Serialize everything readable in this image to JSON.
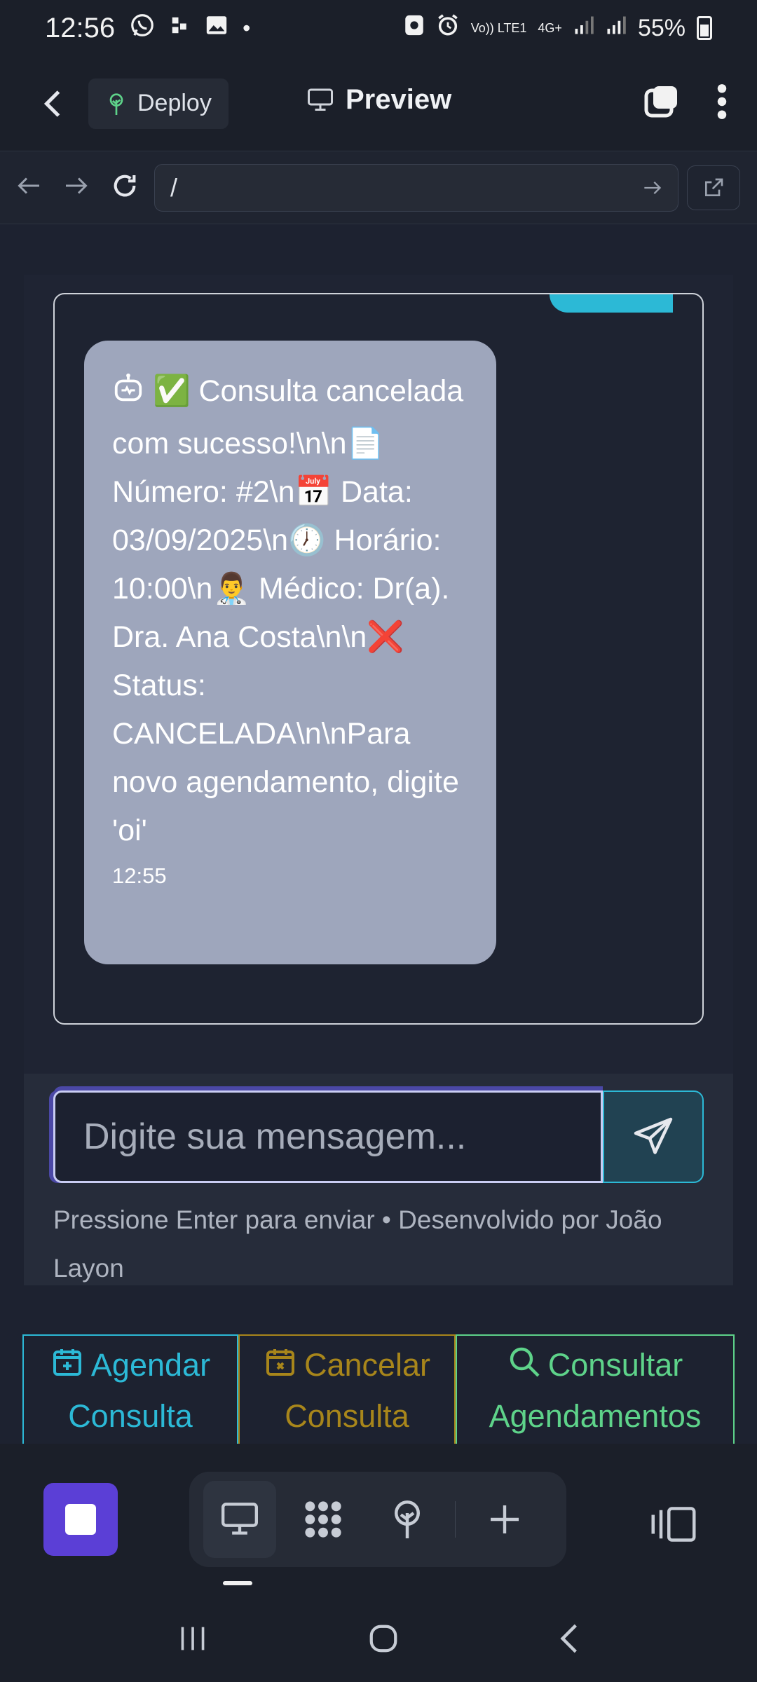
{
  "status_bar": {
    "time": "12:56",
    "network_label": "Vo)) LTE1",
    "network_label2": "4G+",
    "battery": "55%"
  },
  "top_bar": {
    "deploy_label": "Deploy",
    "preview_label": "Preview"
  },
  "url_bar": {
    "value": "/"
  },
  "chat": {
    "message": {
      "text": "✅ Consulta cancelada com sucesso!\\n\\n📄 Número: #2\\n📅 Data: 03/09/2025\\n🕖 Horário: 10:00\\n👨‍⚕️ Médico: Dr(a). Dra. Ana Costa\\n\\n❌ Status: CANCELADA\\n\\nPara novo agendamento, digite 'oi'",
      "time": "12:55"
    },
    "input_placeholder": "Digite sua mensagem...",
    "hint": "Pressione Enter para enviar • Desenvolvido por João Layon"
  },
  "quick_actions": {
    "agendar": "Agendar Consulta",
    "cancelar": "Cancelar Consulta",
    "consultar": "Consultar Agendamentos"
  },
  "colors": {
    "accent_cyan": "#2cb9d6",
    "accent_gold": "#a8861b",
    "accent_green": "#5ed38a",
    "stop_purple": "#5b3fd6",
    "bubble_gray": "#9ea6bc"
  }
}
